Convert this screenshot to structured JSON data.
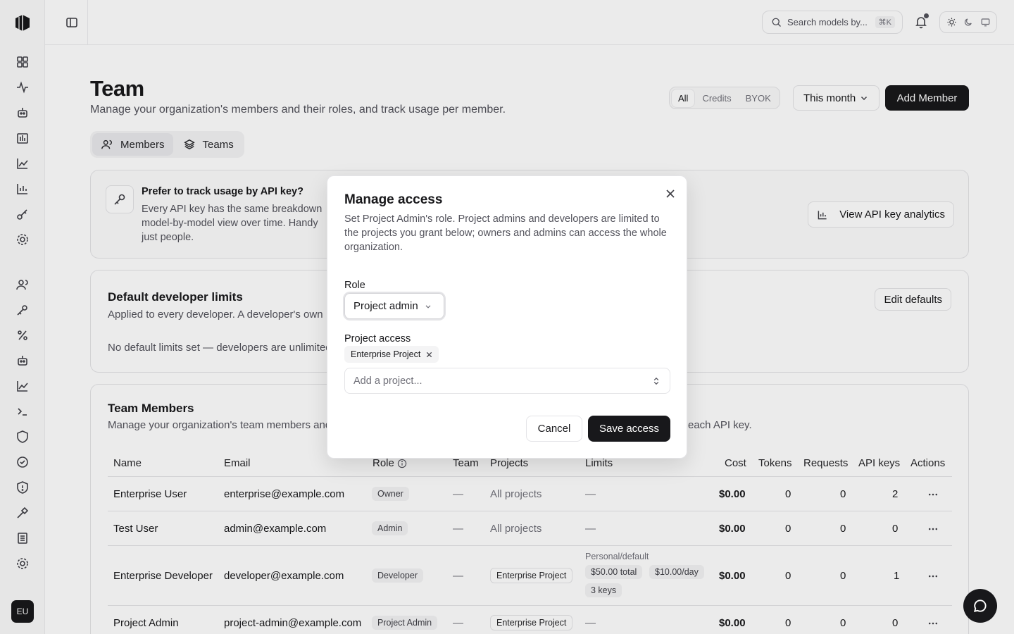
{
  "sidebar": {
    "icons": [
      "dashboard-icon",
      "activity-icon",
      "bot-icon",
      "bar-chart-icon",
      "line-chart-icon",
      "analytics-icon",
      "key-icon",
      "settings-icon",
      "users-icon",
      "key-alt-icon",
      "percent-icon",
      "bot-alt-icon",
      "trend-icon",
      "terminal-icon",
      "shield-icon",
      "check-circle-icon",
      "shield-alert-icon",
      "hammer-icon",
      "building-icon",
      "gear-icon"
    ],
    "avatar": "EU"
  },
  "topbar": {
    "search_placeholder": "Search models by...",
    "search_shortcut": "⌘K"
  },
  "page": {
    "title": "Team",
    "subtitle": "Manage your organization's members and their roles, and track usage per member.",
    "filters": [
      "All",
      "Credits",
      "BYOK"
    ],
    "period": "This month",
    "add_member": "Add Member",
    "tabs": [
      "Members",
      "Teams"
    ]
  },
  "api_card": {
    "title": "Prefer to track usage by API key?",
    "body": "Every API key has the same breakdown model-by-model view over time. Handy just people.",
    "button": "View API key analytics"
  },
  "limits_card": {
    "title": "Default developer limits",
    "subtitle": "Applied to every developer. A developer's own",
    "empty": "No default limits set — developers are unlimited",
    "button": "Edit defaults"
  },
  "members_card": {
    "title": "Team Members",
    "subtitle": "Manage your organization's team members and",
    "subtitle_tail": "each API key.",
    "columns": [
      "Name",
      "Email",
      "Role",
      "Team",
      "Projects",
      "Limits",
      "Cost",
      "Tokens",
      "Requests",
      "API keys",
      "Actions"
    ],
    "rows": [
      {
        "name": "Enterprise User",
        "email": "enterprise@example.com",
        "role": "Owner",
        "team": "—",
        "projects": "All projects",
        "limits": "—",
        "cost": "$0.00",
        "tokens": "0",
        "requests": "0",
        "keys": "2"
      },
      {
        "name": "Test User",
        "email": "admin@example.com",
        "role": "Admin",
        "team": "—",
        "projects": "All projects",
        "limits": "—",
        "cost": "$0.00",
        "tokens": "0",
        "requests": "0",
        "keys": "0"
      },
      {
        "name": "Enterprise Developer",
        "email": "developer@example.com",
        "role": "Developer",
        "team": "—",
        "projects": "Enterprise Project",
        "limits_label": "Personal/default",
        "limit_a": "$50.00 total",
        "limit_b": "$10.00/day",
        "limit_c": "3 keys",
        "cost": "$0.00",
        "tokens": "0",
        "requests": "0",
        "keys": "1"
      },
      {
        "name": "Project Admin",
        "email": "project-admin@example.com",
        "role": "Project Admin",
        "team": "—",
        "projects": "Enterprise Project",
        "limits": "—",
        "cost": "$0.00",
        "tokens": "0",
        "requests": "0",
        "keys": "0"
      }
    ]
  },
  "modal": {
    "title": "Manage access",
    "description": "Set Project Admin's role. Project admins and developers are limited to the projects you grant below; owners and admins can access the whole organization.",
    "role_label": "Role",
    "role_value": "Project admin",
    "project_access_label": "Project access",
    "chip": "Enterprise Project",
    "combo_placeholder": "Add a project...",
    "cancel": "Cancel",
    "save": "Save access"
  }
}
